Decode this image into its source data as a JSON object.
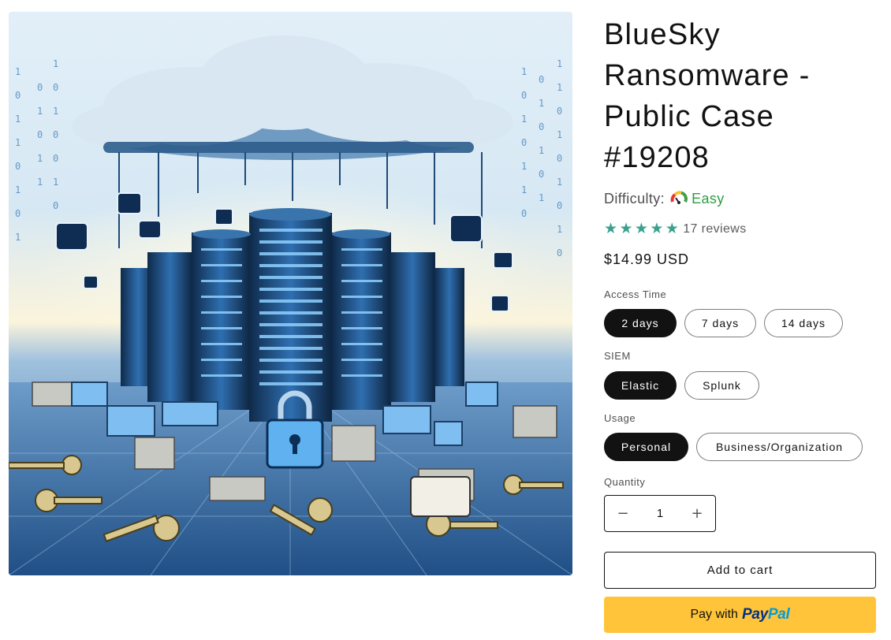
{
  "product": {
    "image_alt": "Ransomware illustration with servers, padlocks and keys",
    "title": "BlueSky Ransomware - Public Case #19208",
    "difficulty_label": "Difficulty:",
    "difficulty_value": "Easy",
    "rating_stars": 5,
    "reviews_text": "17 reviews",
    "price": "$14.99 USD"
  },
  "options": {
    "access_time": {
      "label": "Access Time",
      "values": [
        "2 days",
        "7 days",
        "14 days"
      ],
      "selected": "2 days"
    },
    "siem": {
      "label": "SIEM",
      "values": [
        "Elastic",
        "Splunk"
      ],
      "selected": "Elastic"
    },
    "usage": {
      "label": "Usage",
      "values": [
        "Personal",
        "Business/Organization"
      ],
      "selected": "Personal"
    }
  },
  "quantity": {
    "label": "Quantity",
    "value": "1",
    "minus": "−",
    "plus": "+"
  },
  "buttons": {
    "add_to_cart": "Add to cart",
    "paypal_prefix": "Pay with",
    "paypal_brand_1": "Pay",
    "paypal_brand_2": "Pal"
  },
  "colors": {
    "accent": "#121212",
    "easy": "#2e9e44",
    "stars": "#3aa18f",
    "paypal_bg": "#ffc439"
  }
}
